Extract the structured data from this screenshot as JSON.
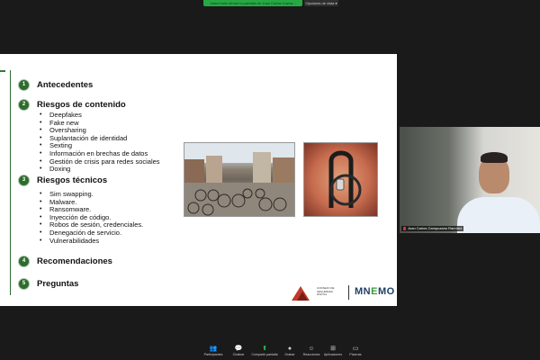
{
  "top_bar": {
    "share_banner": "Usted está viendo la pantalla de Juan Carlos Cueva...",
    "view_options": "Opciones de vista ▾"
  },
  "slide": {
    "sections": [
      {
        "num": "1",
        "title": "Antecedentes"
      },
      {
        "num": "2",
        "title": "Riesgos de contenido"
      },
      {
        "num": "3",
        "title": "Riesgos técnicos"
      },
      {
        "num": "4",
        "title": "Recomendaciones"
      },
      {
        "num": "5",
        "title": "Preguntas"
      }
    ],
    "content_risks": [
      "Deepfakes",
      "Fake new",
      "Oversharing",
      "Suplantación de identidad",
      "Sexting",
      "Información en brechas de datos",
      "Gestión de crisis para redes sociales",
      "Doxing"
    ],
    "technical_risks": [
      "Sim swapping.",
      "Malware.",
      "Ransomware.",
      "Inyección de código.",
      "Robos de sesión, credenciales.",
      "Denegación de servicio.",
      "Vulnerabilidades"
    ],
    "logo_small_text": "CONSEJO DE SEGURIDAD DIGITAL",
    "logo_brand_a": "MN",
    "logo_brand_e": "E",
    "logo_brand_b": "MO"
  },
  "video": {
    "participant_name": "Juan Carlos Campuzano Ramírez"
  },
  "toolbar": {
    "items": [
      {
        "icon": "participants-icon",
        "glyph": "👥",
        "label": "Participantes"
      },
      {
        "icon": "chat-icon",
        "glyph": "💬",
        "label": "Chatear"
      },
      {
        "icon": "share-screen-icon",
        "glyph": "⬆",
        "label": "Compartir pantalla"
      },
      {
        "icon": "record-icon",
        "glyph": "●",
        "label": "Grabar"
      },
      {
        "icon": "reactions-icon",
        "glyph": "☺",
        "label": "Reacciones"
      },
      {
        "icon": "apps-icon",
        "glyph": "⊞",
        "label": "Aplicaciones"
      },
      {
        "icon": "whiteboards-icon",
        "glyph": "▭",
        "label": "Pizarras"
      }
    ]
  }
}
